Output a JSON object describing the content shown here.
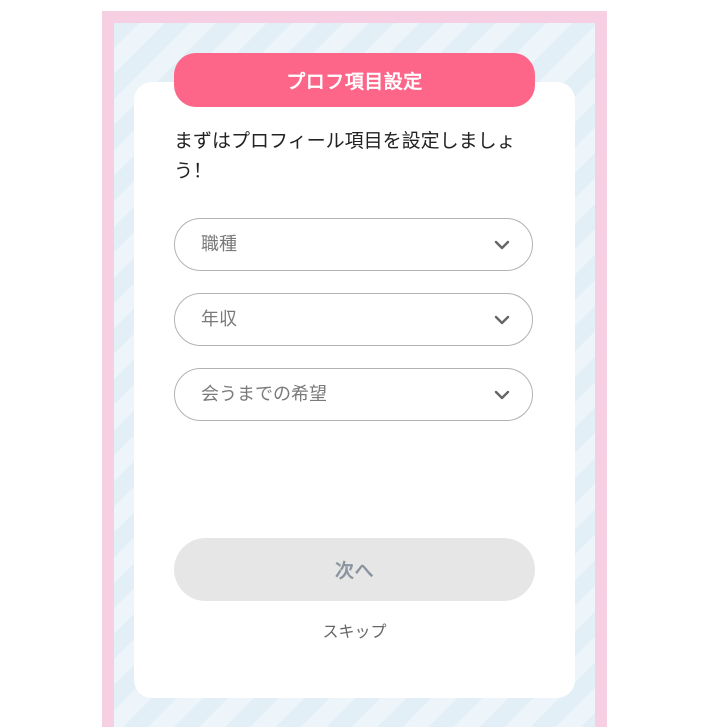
{
  "header": {
    "title": "プロフ項目設定"
  },
  "intro": {
    "text": "まずはプロフィール項目を設定しましょう！"
  },
  "fields": [
    {
      "placeholder": "職種",
      "icon": "chevron-down-icon"
    },
    {
      "placeholder": "年収",
      "icon": "chevron-down-icon"
    },
    {
      "placeholder": "会うまでの希望",
      "icon": "chevron-down-icon"
    }
  ],
  "actions": {
    "next_label": "次へ",
    "skip_label": "スキップ"
  },
  "colors": {
    "accent": "#fd6589",
    "frame": "#f7cfe2",
    "background_stripe": "#e3eff6",
    "disabled_button": "#e6e6e6",
    "disabled_text": "#8a94a0"
  }
}
